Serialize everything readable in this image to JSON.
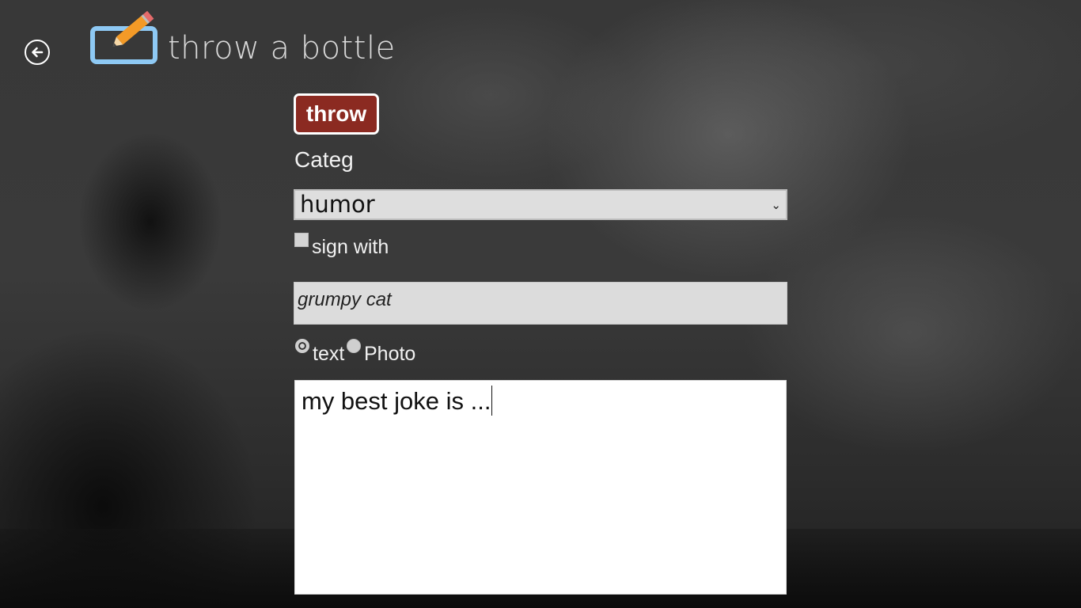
{
  "header": {
    "title": "throw a bottle",
    "back_icon": "back-arrow-icon",
    "logo_icon": "pencil-on-slate-icon"
  },
  "form": {
    "throw_button_label": "throw",
    "category_label": "Categ",
    "category_selected": "humor",
    "sign_label": "sign with",
    "sign_checked": false,
    "signature_value": "grumpy cat",
    "type_options": [
      {
        "label": "text",
        "selected": true
      },
      {
        "label": "Photo",
        "selected": false
      }
    ],
    "message_value": "my best joke is ..."
  },
  "colors": {
    "throw_button_bg": "#8b2a21",
    "logo_blue": "#8ec9f4",
    "pencil_orange": "#f39a27"
  }
}
